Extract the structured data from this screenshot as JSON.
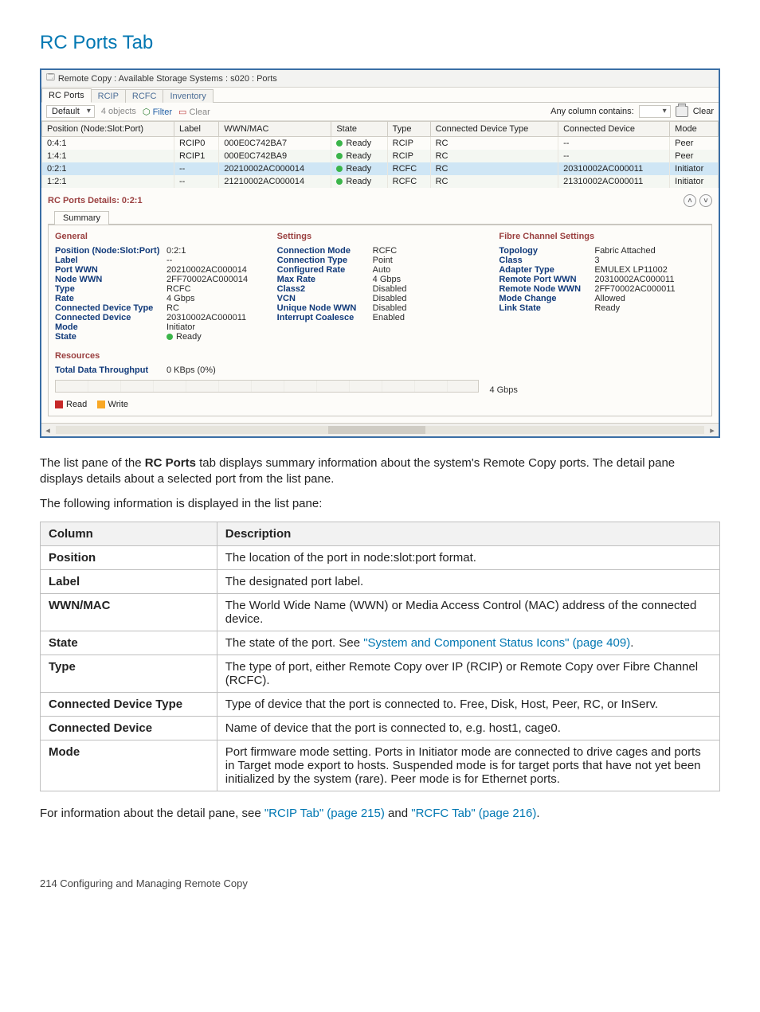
{
  "page_title": "RC Ports Tab",
  "window": {
    "title": "Remote Copy : Available Storage Systems : s020 : Ports",
    "tabs": [
      "RC Ports",
      "RCIP",
      "RCFC",
      "Inventory"
    ],
    "active_tab_index": 0,
    "toolbar": {
      "dropdown": "Default",
      "objects": "4 objects",
      "filter": "Filter",
      "clear": "Clear",
      "search_label": "Any column contains:",
      "clear_right": "Clear"
    },
    "columns": [
      "Position (Node:Slot:Port)",
      "Label",
      "WWN/MAC",
      "State",
      "Type",
      "Connected Device Type",
      "Connected Device",
      "Mode"
    ],
    "rows": [
      {
        "pos": "0:4:1",
        "label": "RCIP0",
        "wwn": "000E0C742BA7",
        "state": "Ready",
        "type": "RCIP",
        "cdtype": "RC",
        "cdev": "--",
        "mode": "Peer"
      },
      {
        "pos": "1:4:1",
        "label": "RCIP1",
        "wwn": "000E0C742BA9",
        "state": "Ready",
        "type": "RCIP",
        "cdtype": "RC",
        "cdev": "--",
        "mode": "Peer"
      },
      {
        "pos": "0:2:1",
        "label": "--",
        "wwn": "20210002AC000014",
        "state": "Ready",
        "type": "RCFC",
        "cdtype": "RC",
        "cdev": "20310002AC000011",
        "mode": "Initiator",
        "sel": true
      },
      {
        "pos": "1:2:1",
        "label": "--",
        "wwn": "21210002AC000014",
        "state": "Ready",
        "type": "RCFC",
        "cdtype": "RC",
        "cdev": "21310002AC000011",
        "mode": "Initiator"
      }
    ],
    "details": {
      "header": "RC Ports Details: 0:2:1",
      "subtab": "Summary",
      "general_title": "General",
      "settings_title": "Settings",
      "fcs_title": "Fibre Channel Settings",
      "general": {
        "Position (Node:Slot:Port)": "0:2:1",
        "Label": "--",
        "Port WWN": "20210002AC000014",
        "Node WWN": "2FF70002AC000014",
        "Type": "RCFC",
        "Rate": "4 Gbps",
        "Connected Device Type": "RC",
        "Connected Device": "20310002AC000011",
        "Mode": "Initiator",
        "State": "Ready"
      },
      "settings": {
        "Connection Mode": "RCFC",
        "Connection Type": "Point",
        "Configured Rate": "Auto",
        "Max Rate": "4 Gbps",
        "Class2": "Disabled",
        "VCN": "Disabled",
        "Unique Node WWN": "Disabled",
        "Interrupt Coalesce": "Enabled"
      },
      "fcs": {
        "Topology": "Fabric Attached",
        "Class": "3",
        "Adapter Type": "EMULEX LP11002",
        "Remote Port WWN": "20310002AC000011",
        "Remote Node WWN": "2FF70002AC000011",
        "Mode Change": "Allowed",
        "Link State": "Ready"
      },
      "resources_title": "Resources",
      "throughput_label": "Total Data Throughput",
      "throughput_value": "0 KBps (0%)",
      "bar_max": "4 Gbps",
      "legend_read": "Read",
      "legend_write": "Write"
    }
  },
  "body_text": {
    "p1_a": "The list pane of the ",
    "p1_bold": "RC Ports",
    "p1_b": " tab displays summary information about the system's Remote Copy ports. The detail pane displays details about a selected port from the list pane.",
    "p2": "The following information is displayed in the list pane:"
  },
  "desc_table": {
    "head": [
      "Column",
      "Description"
    ],
    "rows": [
      {
        "c": "Position",
        "d_plain": "The location of the port in node:slot:port format."
      },
      {
        "c": "Label",
        "d_plain": "The designated port label."
      },
      {
        "c": "WWN/MAC",
        "d_plain": "The World Wide Name (WWN) or Media Access Control (MAC) address of the connected device."
      },
      {
        "c": "State",
        "d_pre": "The state of the port. See ",
        "d_link": "\"System and Component Status Icons\" (page 409)",
        "d_post": "."
      },
      {
        "c": "Type",
        "d_plain": "The type of port, either Remote Copy over IP (RCIP) or Remote Copy over Fibre Channel (RCFC)."
      },
      {
        "c": "Connected Device Type",
        "d_plain": "Type of device that the port is connected to. Free, Disk, Host, Peer, RC, or InServ."
      },
      {
        "c": "Connected Device",
        "d_plain": "Name of device that the port is connected to, e.g. host1, cage0."
      },
      {
        "c": "Mode",
        "d_plain": "Port firmware mode setting. Ports in Initiator mode are connected to drive cages and ports in Target mode export to hosts. Suspended mode is for target ports that have not yet been initialized by the system (rare). Peer mode is for Ethernet ports."
      }
    ]
  },
  "closing": {
    "pre": "For information about the detail pane, see ",
    "link1": "\"RCIP Tab\" (page 215)",
    "mid": " and ",
    "link2": "\"RCFC Tab\" (page 216)",
    "post": "."
  },
  "footer": "214   Configuring and Managing Remote Copy"
}
